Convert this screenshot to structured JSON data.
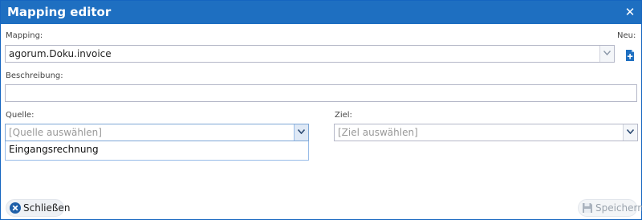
{
  "dialog": {
    "title": "Mapping editor",
    "close_icon": "close-icon"
  },
  "mapping": {
    "label": "Mapping:",
    "value": "agorum.Doku.invoice",
    "new_label": "Neu:",
    "new_icon": "new-document-icon"
  },
  "description": {
    "label": "Beschreibung:",
    "value": ""
  },
  "source": {
    "label": "Quelle:",
    "placeholder": "[Quelle auswählen]",
    "options": [
      "Eingangsrechnung"
    ]
  },
  "target": {
    "label": "Ziel:",
    "placeholder": "[Ziel auswählen]"
  },
  "footer": {
    "close_label": "Schließen",
    "close_icon": "close-circle-icon",
    "save_label": "Speichern",
    "save_icon": "save-icon"
  },
  "colors": {
    "titlebar": "#1e6fc1",
    "accent": "#1565c0"
  }
}
